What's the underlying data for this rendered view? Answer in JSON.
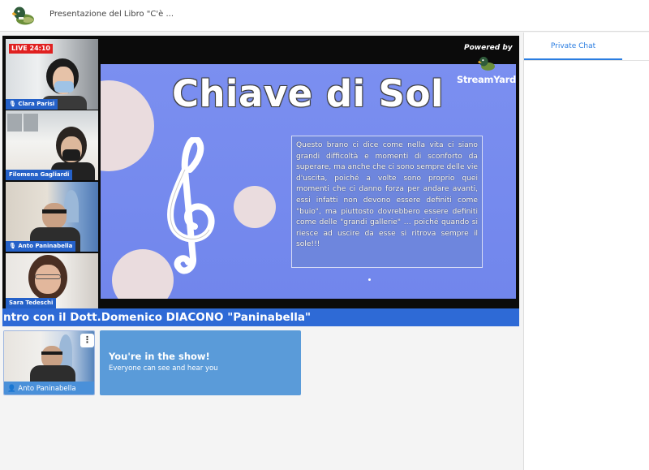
{
  "header": {
    "page_title": "Presentazione del Libro \"C'è ...",
    "logo_icon": "streamyard-duck-icon"
  },
  "chat_panel": {
    "tab_label": "Private Chat"
  },
  "stage": {
    "live_badge": "LIVE 24:10",
    "powered_by": "Powered by",
    "brand_name": "StreamYard",
    "participants": [
      {
        "name": "Clara Parisi",
        "mic_icon": true
      },
      {
        "name": "Filomena Gagliardi",
        "mic_icon": false
      },
      {
        "name": "Anto Paninabella",
        "mic_icon": true
      },
      {
        "name": "Sara Tedeschi",
        "mic_icon": false
      }
    ],
    "slide": {
      "title": "Chiave di Sol",
      "body": "Questo brano ci dice come nella vita ci siano grandi difficoltà e momenti di sconforto da superare, ma anche che ci sono sempre delle vie d'uscita, poiché a volte sono proprio quei momenti che ci danno forza per andare avanti, essi infatti non devono essere definiti come \"buio\", ma piuttosto dovrebbero essere definiti come delle \"grandi gallerie\" … poiché quando si riesce ad uscire da esse si ritrova sempre il sole!!!"
    },
    "banner_text": "ntro con il Dott.Domenico DIACONO \"Paninabella\""
  },
  "self_view": {
    "name": "Anto Paninabella",
    "menu_icon": "more-vertical-icon"
  },
  "in_show": {
    "title": "You're in the show!",
    "subtitle": "Everyone can see and hear you"
  },
  "colors": {
    "accent": "#2a7de1",
    "banner": "#2e6ad6",
    "slide_bg": "#7186ec",
    "live": "#e02020"
  }
}
